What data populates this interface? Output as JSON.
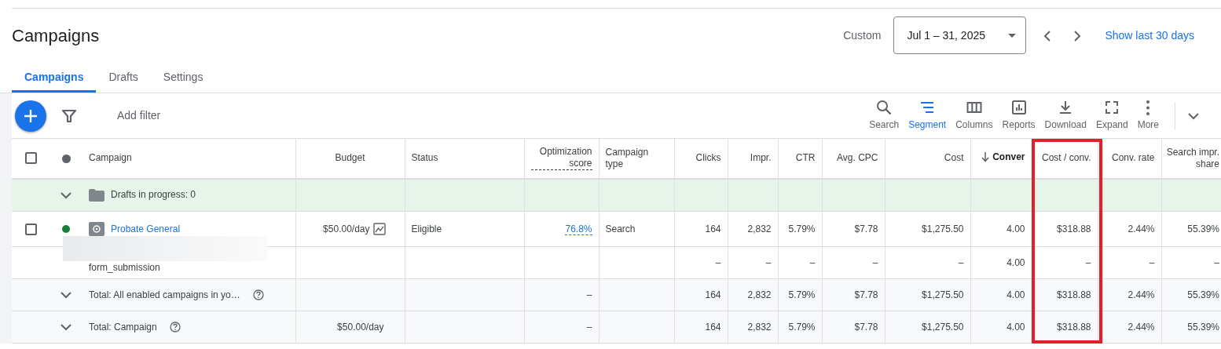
{
  "page": {
    "title": "Campaigns"
  },
  "date_range": {
    "label": "Custom",
    "value": "Jul 1 – 31, 2025",
    "link": "Show last 30 days"
  },
  "tabs": [
    {
      "label": "Campaigns",
      "selected": true
    },
    {
      "label": "Drafts",
      "selected": false
    },
    {
      "label": "Settings",
      "selected": false
    }
  ],
  "toolbar": {
    "filter_label": "Add filter",
    "items": [
      {
        "kind": "search",
        "label": "Search",
        "active": false
      },
      {
        "kind": "segment",
        "label": "Segment",
        "active": true
      },
      {
        "kind": "columns",
        "label": "Columns",
        "active": false
      },
      {
        "kind": "reports",
        "label": "Reports",
        "active": false
      },
      {
        "kind": "download",
        "label": "Download",
        "active": false
      },
      {
        "kind": "expand",
        "label": "Expand",
        "active": false
      },
      {
        "kind": "more",
        "label": "More",
        "active": false
      }
    ]
  },
  "table": {
    "select_all": {
      "checked": false
    },
    "columns": [
      {
        "label": "Campaign"
      },
      {
        "label": "Budget"
      },
      {
        "label": "Status"
      },
      {
        "label": "Optimization score",
        "dashed": true
      },
      {
        "label": "Campaign type"
      },
      {
        "label": "Clicks"
      },
      {
        "label": "Impr."
      },
      {
        "label": "CTR"
      },
      {
        "label": "Avg. CPC"
      },
      {
        "label": "Cost"
      },
      {
        "label": "Conver",
        "sorted": true
      },
      {
        "label": "Cost / conv.",
        "highlighted": true
      },
      {
        "label": "Conv. rate"
      },
      {
        "label": "Search impr. share"
      }
    ],
    "rows": [
      {
        "kind": "drafts",
        "cells": [
          "Drafts in progress: 0"
        ]
      },
      {
        "kind": "campaign",
        "checked": false,
        "color": "#188038",
        "cells": [
          "Probate General",
          "$50.00/day",
          "Eligible",
          "76.8%",
          "Search",
          "164",
          "2,832",
          "5.79%",
          "$7.78",
          "$1,275.50",
          "4.00",
          "$318.88",
          "2.44%",
          "55.39%"
        ]
      },
      {
        "kind": "conversion",
        "redacted": true,
        "cells": [
          "form_submission",
          "",
          "",
          "",
          "",
          "–",
          "–",
          "–",
          "–",
          "–",
          "4.00",
          "–",
          "–",
          "–"
        ]
      },
      {
        "kind": "total",
        "cells": [
          "Total: All enabled campaigns in yo…",
          "",
          "",
          "–",
          "",
          "164",
          "2,832",
          "5.79%",
          "$7.78",
          "$1,275.50",
          "4.00",
          "$318.88",
          "2.44%",
          "55.39%"
        ]
      },
      {
        "kind": "total",
        "cells": [
          "Total: Campaign",
          "$50.00/day",
          "",
          "–",
          "",
          "164",
          "2,832",
          "5.79%",
          "$7.78",
          "$1,275.50",
          "4.00",
          "$318.88",
          "2.44%",
          "55.39%"
        ]
      }
    ]
  }
}
